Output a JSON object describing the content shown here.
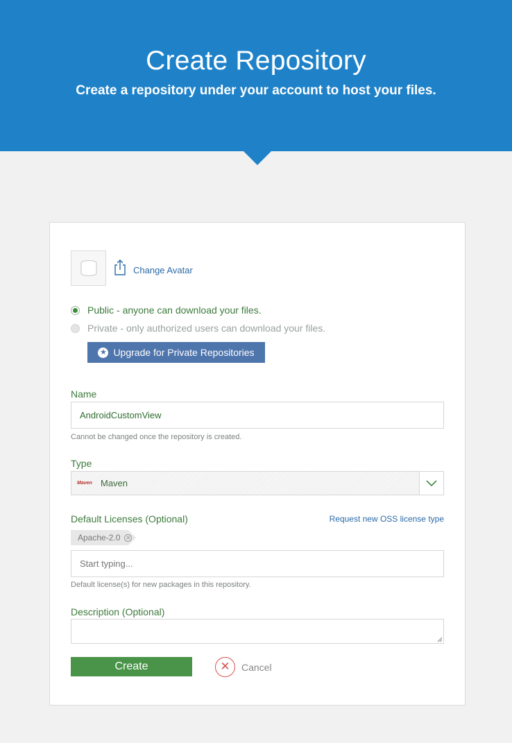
{
  "header": {
    "title": "Create Repository",
    "subtitle": "Create a repository under your account to host your files."
  },
  "avatar": {
    "icon": "database-icon",
    "change_label": "Change Avatar",
    "change_icon": "upload-icon"
  },
  "visibility": {
    "public_label": "Public - anyone can download your files.",
    "private_label": "Private - only authorized users can download your files.",
    "selected": "public",
    "upgrade_label": "Upgrade for Private Repositories",
    "upgrade_icon": "star-icon"
  },
  "name": {
    "label": "Name",
    "value": "AndroidCustomView",
    "help": "Cannot be changed once the repository is created."
  },
  "type": {
    "label": "Type",
    "logo_text": "Maven",
    "value": "Maven"
  },
  "licenses": {
    "label": "Default Licenses (Optional)",
    "request_link": "Request new OSS license type",
    "tags": [
      "Apache-2.0"
    ],
    "placeholder": "Start typing...",
    "help": "Default license(s) for new packages in this repository."
  },
  "description": {
    "label": "Description (Optional)",
    "value": ""
  },
  "actions": {
    "create_label": "Create",
    "cancel_label": "Cancel"
  },
  "colors": {
    "header_blue": "#1f82c9",
    "green": "#4a9449",
    "upgrade_blue": "#4f75ad",
    "link_blue": "#2a6aa6",
    "cancel_red": "#d9534f"
  }
}
